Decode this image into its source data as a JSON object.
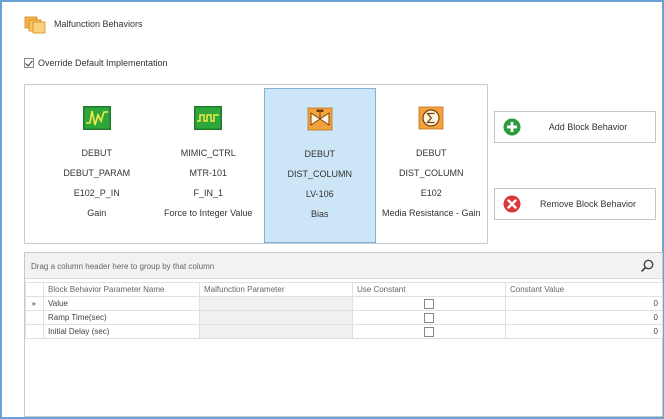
{
  "header": {
    "title": "Malfunction Behaviors",
    "icon": "folder-stack-icon"
  },
  "override": {
    "label": "Override Default Implementation",
    "checked": true
  },
  "blocks": [
    {
      "icon": "waveform-icon",
      "line1": "DEBUT",
      "line2": "DEBUT_PARAM",
      "line3": "E102_P_IN",
      "line4": "Gain",
      "selected": false
    },
    {
      "icon": "digital-signal-icon",
      "line1": "MIMIC_CTRL",
      "line2": "MTR-101",
      "line3": "F_IN_1",
      "line4": "Force to Integer Value",
      "selected": false
    },
    {
      "icon": "valve-icon",
      "line1": "DEBUT",
      "line2": "DIST_COLUMN",
      "line3": "LV-106",
      "line4": "Bias",
      "selected": true
    },
    {
      "icon": "sum-icon",
      "line1": "DEBUT",
      "line2": "DIST_COLUMN",
      "line3": "E102",
      "line4": "Media Resistance - Gain",
      "selected": false
    }
  ],
  "buttons": {
    "add": {
      "label": "Add Block Behavior",
      "icon": "plus-circle-icon",
      "color": "#2e9a3e"
    },
    "remove": {
      "label": "Remove Block Behavior",
      "icon": "x-circle-icon",
      "color": "#d9383a"
    }
  },
  "grid": {
    "group_text": "Drag a column header here to group by that column",
    "columns": [
      "Block Behavior Parameter Name",
      "Malfunction Parameter",
      "Use Constant",
      "Constant Value"
    ],
    "rows": [
      {
        "indicator": "▸",
        "name": "Value",
        "malfunction_parameter": "",
        "use_constant": false,
        "constant_value": "0"
      },
      {
        "indicator": "",
        "name": "Ramp Time(sec)",
        "malfunction_parameter": "",
        "use_constant": false,
        "constant_value": "0"
      },
      {
        "indicator": "",
        "name": "Initial Delay (sec)",
        "malfunction_parameter": "",
        "use_constant": false,
        "constant_value": "0"
      }
    ]
  },
  "colors": {
    "frame_border": "#6aa2d6",
    "selected_bg": "#cde6f7",
    "selected_border": "#7fb3da"
  }
}
